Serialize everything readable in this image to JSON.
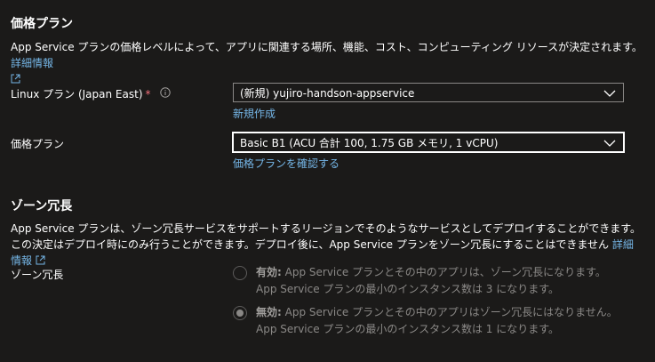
{
  "pricing": {
    "title": "価格プラン",
    "description": "App Service プランの価格レベルによって、アプリに関連する場所、機能、コスト、コンピューティング リソースが決定されます。",
    "details_link": "詳細情報",
    "linux_plan_label": "Linux プラン (Japan East)",
    "required_mark": "*",
    "linux_plan_value": "(新規) yujiro-handson-appservice",
    "create_new_link": "新規作成",
    "pricing_plan_label": "価格プラン",
    "pricing_plan_value": "Basic B1 (ACU 合計 100, 1.75 GB メモリ, 1 vCPU)",
    "check_plans_link": "価格プランを確認する"
  },
  "zone": {
    "title": "ゾーン冗長",
    "description": "App Service プランは、ゾーン冗長サービスをサポートするリージョンでそのようなサービスとしてデプロイすることができます。この決定はデプロイ時にのみ行うことができます。デプロイ後に、App Service プランをゾーン冗長にすることはできません",
    "details_link": "詳細情報",
    "label": "ゾーン冗長",
    "options": [
      {
        "title": "有効:",
        "text": "App Service プランとその中のアプリは、ゾーン冗長になります。App Service プランの最小のインスタンス数は 3 になります。",
        "checked": false
      },
      {
        "title": "無効:",
        "text": "App Service プランとその中のアプリはゾーン冗長にはなりません。App Service プランの最小のインスタンス数は 1 になります。",
        "checked": true
      }
    ]
  },
  "colors": {
    "background": "#1b1a19",
    "link": "#75b6e7",
    "required": "#f1707b",
    "disabled_text": "#8a8886"
  }
}
